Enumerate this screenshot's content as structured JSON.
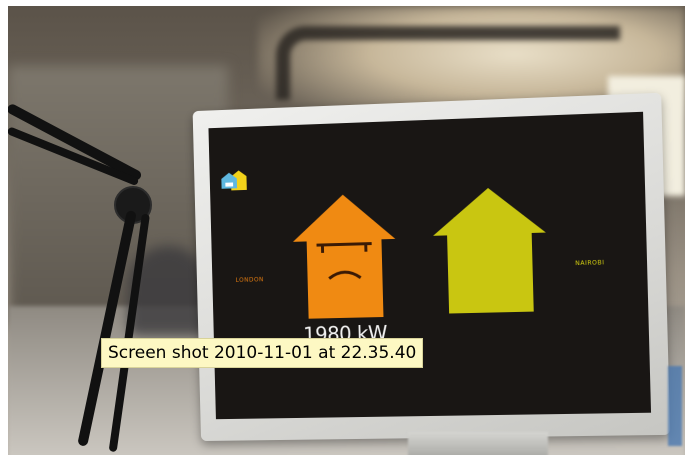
{
  "photo": {
    "screen_label_left": "LONDON",
    "screen_label_right": "NAIROBI",
    "power_reading": "1980 kW",
    "left_house_color": "#f08a12",
    "right_house_color": "#c9c611"
  },
  "tooltip": {
    "text": "Screen shot 2010-11-01 at 22.35.40"
  }
}
